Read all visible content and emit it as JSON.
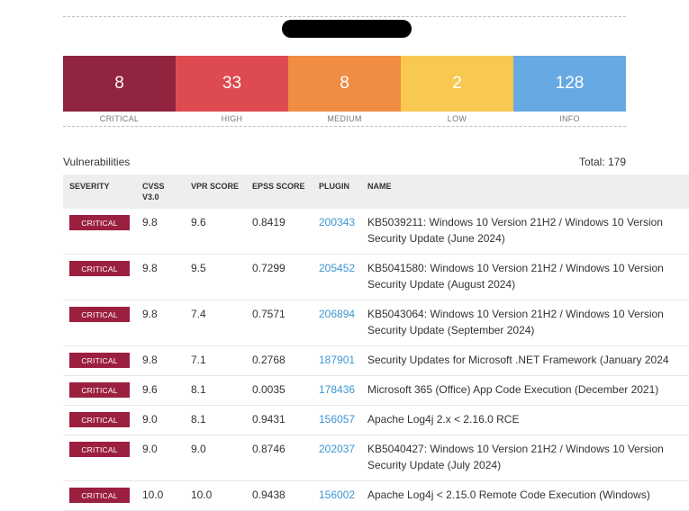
{
  "severity_summary": [
    {
      "count": "8",
      "label": "CRITICAL",
      "color": "#91243e"
    },
    {
      "count": "33",
      "label": "HIGH",
      "color": "#dd4b50"
    },
    {
      "count": "8",
      "label": "MEDIUM",
      "color": "#f18c43"
    },
    {
      "count": "2",
      "label": "LOW",
      "color": "#f8c851"
    },
    {
      "count": "128",
      "label": "INFO",
      "color": "#67a9e3"
    }
  ],
  "section_title": "Vulnerabilities",
  "total": "Total: 179",
  "columns": {
    "severity": "SEVERITY",
    "cvss": "CVSS",
    "cvss_version": "V3.0",
    "vpr": "VPR SCORE",
    "epss": "EPSS SCORE",
    "plugin": "PLUGIN",
    "name": "NAME"
  },
  "rows": [
    {
      "severity": "CRITICAL",
      "cvss": "9.8",
      "vpr": "9.6",
      "epss": "0.8419",
      "plugin": "200343",
      "name_line1": "KB5039211: Windows 10 Version 21H2 / Windows 10 Version",
      "name_line2": "Security Update (June 2024)"
    },
    {
      "severity": "CRITICAL",
      "cvss": "9.8",
      "vpr": "9.5",
      "epss": "0.7299",
      "plugin": "205452",
      "name_line1": "KB5041580: Windows 10 Version 21H2 / Windows 10 Version",
      "name_line2": "Security Update (August 2024)"
    },
    {
      "severity": "CRITICAL",
      "cvss": "9.8",
      "vpr": "7.4",
      "epss": "0.7571",
      "plugin": "206894",
      "name_line1": "KB5043064: Windows 10 Version 21H2 / Windows 10 Version",
      "name_line2": "Security Update (September 2024)"
    },
    {
      "severity": "CRITICAL",
      "cvss": "9.8",
      "vpr": "7.1",
      "epss": "0.2768",
      "plugin": "187901",
      "name_line1": "Security Updates for Microsoft .NET Framework (January 2024",
      "name_line2": ""
    },
    {
      "severity": "CRITICAL",
      "cvss": "9.6",
      "vpr": "8.1",
      "epss": "0.0035",
      "plugin": "178436",
      "name_line1": "Microsoft 365 (Office) App Code Execution (December 2021)",
      "name_line2": ""
    },
    {
      "severity": "CRITICAL",
      "cvss": "9.0",
      "vpr": "8.1",
      "epss": "0.9431",
      "plugin": "156057",
      "name_line1": "Apache Log4j 2.x < 2.16.0 RCE",
      "name_line2": ""
    },
    {
      "severity": "CRITICAL",
      "cvss": "9.0",
      "vpr": "9.0",
      "epss": "0.8746",
      "plugin": "202037",
      "name_line1": "KB5040427: Windows 10 Version 21H2 / Windows 10 Version",
      "name_line2": "Security Update (July 2024)"
    },
    {
      "severity": "CRITICAL",
      "cvss": "10.0",
      "vpr": "10.0",
      "epss": "0.9438",
      "plugin": "156002",
      "name_line1": "Apache Log4j < 2.15.0 Remote Code Execution (Windows)",
      "name_line2": ""
    }
  ]
}
